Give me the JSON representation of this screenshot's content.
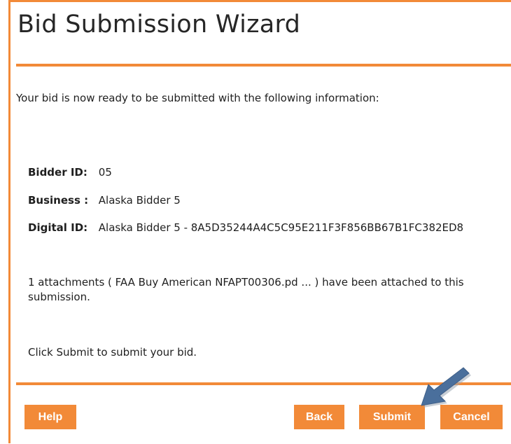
{
  "wizard": {
    "title": "Bid Submission Wizard",
    "intro": "Your bid is now ready to be submitted with the following information:",
    "bidder": {
      "label": "Bidder ID:",
      "value": "05"
    },
    "business": {
      "label": "Business :",
      "value": "Alaska Bidder 5"
    },
    "digital": {
      "label": "Digital ID:",
      "value": "Alaska Bidder 5 - 8A5D35244A4C5C95E211F3F856BB67B1FC382ED8"
    },
    "attachments_text": "1 attachments ( FAA Buy American NFAPT00306.pd ... ) have been attached to this submission.",
    "instruction": "Click Submit to submit your bid."
  },
  "buttons": {
    "help": "Help",
    "back": "Back",
    "submit": "Submit",
    "cancel": "Cancel"
  },
  "colors": {
    "accent": "#f28a38",
    "pointer_arrow": "#4a6f9c",
    "text": "#1f1f1f"
  },
  "icons": {
    "pointer": "arrow-pointer-icon"
  }
}
